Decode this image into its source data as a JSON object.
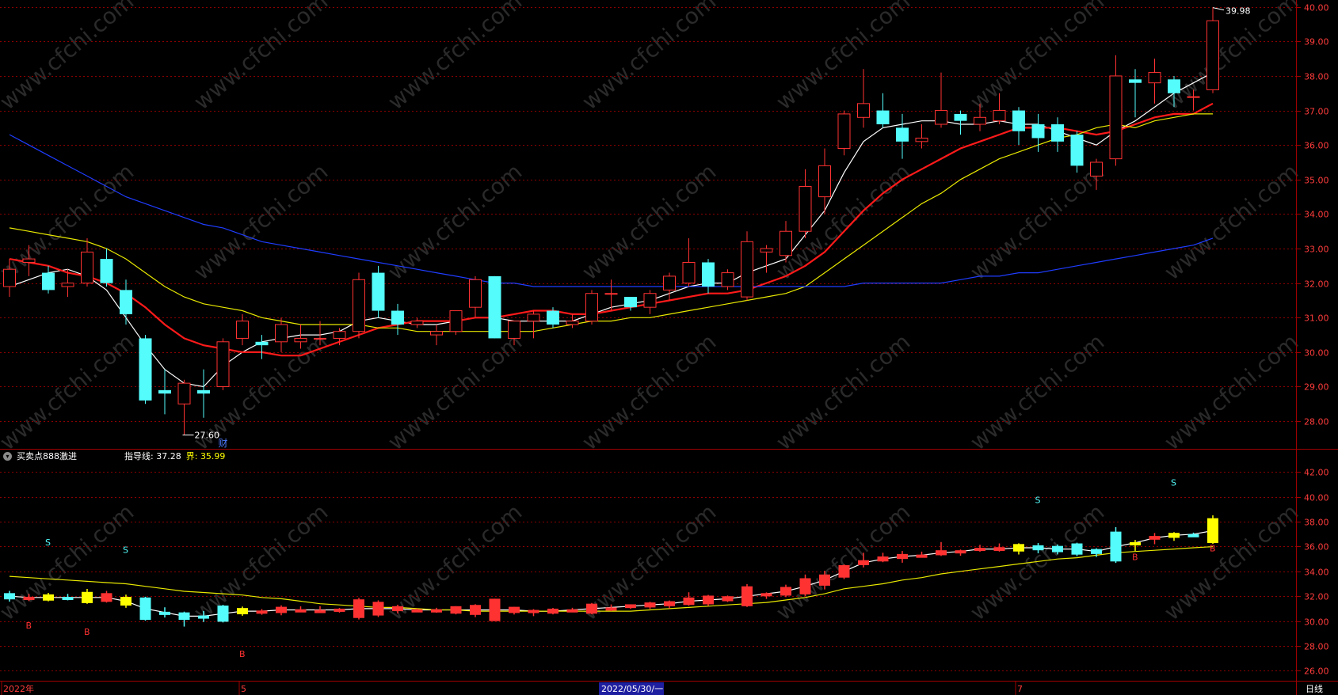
{
  "colors": {
    "background": "#000000",
    "up": "#ff3232",
    "down": "#54fcfc",
    "ma_short": "#ffffff",
    "ma_mid": "#ff1a1a",
    "ma_long": "#e8e800",
    "ma_longest": "#1f3dff",
    "grid": "#8b0000",
    "axis_text": "#ff3c3c",
    "watermark": "#2a2a2a"
  },
  "watermark": "www.cfchi.com",
  "indicator": {
    "name": "买卖点888激进",
    "guide_label": "指导线:",
    "guide_value": "37.28",
    "bound_label": "界:",
    "bound_value": "35.99"
  },
  "bottom_axis": {
    "labels": [
      {
        "text": "2022年",
        "index": 0
      },
      {
        "text": "5",
        "index": 12
      },
      {
        "text": "7",
        "index": 52
      }
    ],
    "cursor_date": "2022/05/30/一",
    "cursor_index": 32,
    "period": "日线"
  },
  "chart_data": [
    {
      "type": "candlestick",
      "ylim": [
        27.2,
        40.2
      ],
      "yticks": [
        "28.00",
        "29.00",
        "30.00",
        "31.00",
        "32.00",
        "33.00",
        "34.00",
        "35.00",
        "36.00",
        "37.00",
        "38.00",
        "39.00",
        "40.00"
      ],
      "annotations": [
        {
          "text": "39.98",
          "index": 62,
          "value": 39.98,
          "kind": "high"
        },
        {
          "text": "27.60",
          "index": 9,
          "value": 27.6,
          "kind": "low"
        },
        {
          "text": "财",
          "index": 11,
          "kind": "marker"
        }
      ],
      "candles": [
        {
          "o": 31.9,
          "h": 32.7,
          "l": 31.6,
          "c": 32.4
        },
        {
          "o": 32.6,
          "h": 33.1,
          "l": 32.2,
          "c": 32.7
        },
        {
          "o": 32.3,
          "h": 32.5,
          "l": 31.7,
          "c": 31.8
        },
        {
          "o": 31.9,
          "h": 32.4,
          "l": 31.6,
          "c": 32.0
        },
        {
          "o": 32.0,
          "h": 33.3,
          "l": 31.9,
          "c": 32.9
        },
        {
          "o": 32.7,
          "h": 33.0,
          "l": 31.9,
          "c": 32.0
        },
        {
          "o": 31.8,
          "h": 32.1,
          "l": 30.8,
          "c": 31.1
        },
        {
          "o": 30.4,
          "h": 30.5,
          "l": 28.5,
          "c": 28.6
        },
        {
          "o": 28.9,
          "h": 29.5,
          "l": 28.2,
          "c": 28.8
        },
        {
          "o": 28.5,
          "h": 29.2,
          "l": 27.6,
          "c": 29.1
        },
        {
          "o": 28.9,
          "h": 29.5,
          "l": 28.1,
          "c": 28.8
        },
        {
          "o": 29.0,
          "h": 30.4,
          "l": 28.9,
          "c": 30.3
        },
        {
          "o": 30.4,
          "h": 31.1,
          "l": 30.2,
          "c": 30.9
        },
        {
          "o": 30.3,
          "h": 30.5,
          "l": 29.8,
          "c": 30.2
        },
        {
          "o": 30.3,
          "h": 31.0,
          "l": 30.0,
          "c": 30.8
        },
        {
          "o": 30.3,
          "h": 30.8,
          "l": 30.1,
          "c": 30.4
        },
        {
          "o": 30.4,
          "h": 30.9,
          "l": 30.2,
          "c": 30.4
        },
        {
          "o": 30.4,
          "h": 30.7,
          "l": 30.2,
          "c": 30.6
        },
        {
          "o": 30.6,
          "h": 32.3,
          "l": 30.4,
          "c": 32.1
        },
        {
          "o": 32.3,
          "h": 32.5,
          "l": 31.0,
          "c": 31.2
        },
        {
          "o": 31.2,
          "h": 31.4,
          "l": 30.5,
          "c": 30.8
        },
        {
          "o": 30.8,
          "h": 31.0,
          "l": 30.7,
          "c": 30.9
        },
        {
          "o": 30.5,
          "h": 30.8,
          "l": 30.2,
          "c": 30.6
        },
        {
          "o": 30.6,
          "h": 31.2,
          "l": 30.5,
          "c": 31.2
        },
        {
          "o": 31.3,
          "h": 32.2,
          "l": 31.0,
          "c": 32.1
        },
        {
          "o": 32.2,
          "h": 32.2,
          "l": 30.4,
          "c": 30.4
        },
        {
          "o": 30.4,
          "h": 30.9,
          "l": 30.2,
          "c": 30.9
        },
        {
          "o": 30.9,
          "h": 31.2,
          "l": 30.4,
          "c": 31.1
        },
        {
          "o": 31.2,
          "h": 31.3,
          "l": 30.7,
          "c": 30.8
        },
        {
          "o": 30.8,
          "h": 31.1,
          "l": 30.7,
          "c": 30.9
        },
        {
          "o": 30.9,
          "h": 31.8,
          "l": 30.8,
          "c": 31.7
        },
        {
          "o": 31.7,
          "h": 32.1,
          "l": 31.2,
          "c": 31.7
        },
        {
          "o": 31.6,
          "h": 31.6,
          "l": 31.2,
          "c": 31.3
        },
        {
          "o": 31.3,
          "h": 31.8,
          "l": 31.1,
          "c": 31.7
        },
        {
          "o": 31.8,
          "h": 32.3,
          "l": 31.5,
          "c": 32.2
        },
        {
          "o": 32.0,
          "h": 33.3,
          "l": 31.9,
          "c": 32.6
        },
        {
          "o": 32.6,
          "h": 32.7,
          "l": 31.7,
          "c": 31.9
        },
        {
          "o": 31.9,
          "h": 32.4,
          "l": 31.8,
          "c": 32.3
        },
        {
          "o": 31.6,
          "h": 33.5,
          "l": 31.5,
          "c": 33.2
        },
        {
          "o": 32.9,
          "h": 33.1,
          "l": 32.3,
          "c": 33.0
        },
        {
          "o": 32.8,
          "h": 33.8,
          "l": 32.6,
          "c": 33.5
        },
        {
          "o": 33.5,
          "h": 35.3,
          "l": 33.3,
          "c": 34.8
        },
        {
          "o": 34.5,
          "h": 35.9,
          "l": 34.0,
          "c": 35.4
        },
        {
          "o": 35.9,
          "h": 37.0,
          "l": 35.7,
          "c": 36.9
        },
        {
          "o": 36.8,
          "h": 38.2,
          "l": 36.5,
          "c": 37.2
        },
        {
          "o": 37.0,
          "h": 37.5,
          "l": 36.5,
          "c": 36.6
        },
        {
          "o": 36.5,
          "h": 36.9,
          "l": 35.6,
          "c": 36.1
        },
        {
          "o": 36.1,
          "h": 36.6,
          "l": 35.9,
          "c": 36.2
        },
        {
          "o": 36.6,
          "h": 38.1,
          "l": 36.5,
          "c": 37.0
        },
        {
          "o": 36.9,
          "h": 37.0,
          "l": 36.3,
          "c": 36.7
        },
        {
          "o": 36.6,
          "h": 37.2,
          "l": 36.4,
          "c": 36.8
        },
        {
          "o": 36.7,
          "h": 37.5,
          "l": 36.6,
          "c": 37.0
        },
        {
          "o": 37.0,
          "h": 37.1,
          "l": 36.0,
          "c": 36.4
        },
        {
          "o": 36.6,
          "h": 36.9,
          "l": 35.8,
          "c": 36.2
        },
        {
          "o": 36.6,
          "h": 36.8,
          "l": 35.8,
          "c": 36.1
        },
        {
          "o": 36.3,
          "h": 36.4,
          "l": 35.2,
          "c": 35.4
        },
        {
          "o": 35.1,
          "h": 35.6,
          "l": 34.7,
          "c": 35.5
        },
        {
          "o": 35.6,
          "h": 38.6,
          "l": 35.4,
          "c": 38.0
        },
        {
          "o": 37.9,
          "h": 38.2,
          "l": 36.8,
          "c": 37.8
        },
        {
          "o": 37.8,
          "h": 38.5,
          "l": 37.2,
          "c": 38.1
        },
        {
          "o": 37.9,
          "h": 38.0,
          "l": 37.1,
          "c": 37.5
        },
        {
          "o": 37.4,
          "h": 37.6,
          "l": 37.0,
          "c": 37.4
        },
        {
          "o": 37.6,
          "h": 39.98,
          "l": 37.5,
          "c": 39.6
        }
      ],
      "series": [
        {
          "color": "#ffffff",
          "values": [
            31.9,
            32.1,
            32.3,
            32.4,
            32.2,
            31.8,
            31.0,
            30.2,
            29.5,
            29.1,
            29.0,
            29.6,
            30.0,
            30.3,
            30.4,
            30.5,
            30.5,
            30.6,
            30.9,
            31.0,
            30.9,
            30.8,
            30.8,
            30.9,
            31.0,
            31.0,
            30.9,
            30.9,
            30.9,
            30.9,
            31.1,
            31.3,
            31.4,
            31.5,
            31.7,
            31.9,
            32.0,
            32.0,
            32.3,
            32.5,
            32.7,
            33.4,
            34.1,
            35.2,
            36.1,
            36.5,
            36.6,
            36.7,
            36.7,
            36.6,
            36.6,
            36.7,
            36.6,
            36.6,
            36.4,
            36.2,
            36.0,
            36.4,
            36.7,
            37.1,
            37.5,
            37.8,
            38.1
          ]
        },
        {
          "color": "#ff1a1a",
          "values": [
            32.7,
            32.6,
            32.5,
            32.3,
            32.2,
            32.0,
            31.7,
            31.3,
            30.8,
            30.4,
            30.2,
            30.1,
            30.0,
            30.0,
            29.9,
            29.9,
            30.1,
            30.3,
            30.5,
            30.7,
            30.8,
            30.9,
            30.9,
            30.9,
            31.0,
            31.0,
            31.1,
            31.2,
            31.2,
            31.1,
            31.1,
            31.2,
            31.3,
            31.4,
            31.5,
            31.6,
            31.7,
            31.7,
            31.8,
            32.0,
            32.2,
            32.5,
            32.9,
            33.5,
            34.1,
            34.6,
            35.0,
            35.3,
            35.6,
            35.9,
            36.1,
            36.3,
            36.5,
            36.5,
            36.5,
            36.4,
            36.3,
            36.4,
            36.6,
            36.8,
            36.9,
            36.9,
            37.2
          ]
        },
        {
          "color": "#e8e800",
          "values": [
            33.6,
            33.5,
            33.4,
            33.3,
            33.2,
            33.0,
            32.7,
            32.3,
            31.9,
            31.6,
            31.4,
            31.3,
            31.2,
            31.0,
            30.9,
            30.8,
            30.8,
            30.8,
            30.8,
            30.7,
            30.7,
            30.6,
            30.6,
            30.6,
            30.6,
            30.6,
            30.6,
            30.6,
            30.7,
            30.8,
            30.9,
            30.9,
            31.0,
            31.0,
            31.1,
            31.2,
            31.3,
            31.4,
            31.5,
            31.6,
            31.7,
            31.9,
            32.3,
            32.7,
            33.1,
            33.5,
            33.9,
            34.3,
            34.6,
            35.0,
            35.3,
            35.6,
            35.8,
            36.0,
            36.2,
            36.3,
            36.5,
            36.6,
            36.5,
            36.7,
            36.8,
            36.9,
            36.9
          ]
        },
        {
          "color": "#1f3dff",
          "values": [
            36.3,
            36.0,
            35.7,
            35.4,
            35.1,
            34.8,
            34.5,
            34.3,
            34.1,
            33.9,
            33.7,
            33.6,
            33.4,
            33.2,
            33.1,
            33.0,
            32.9,
            32.8,
            32.7,
            32.6,
            32.5,
            32.4,
            32.3,
            32.2,
            32.1,
            32.0,
            32.0,
            31.9,
            31.9,
            31.9,
            31.9,
            31.9,
            31.9,
            31.9,
            31.9,
            31.9,
            31.9,
            31.9,
            31.9,
            31.9,
            31.9,
            31.9,
            31.9,
            31.9,
            32.0,
            32.0,
            32.0,
            32.0,
            32.0,
            32.1,
            32.2,
            32.2,
            32.3,
            32.3,
            32.4,
            32.5,
            32.6,
            32.7,
            32.8,
            32.9,
            33.0,
            33.1,
            33.3
          ]
        }
      ]
    },
    {
      "type": "candlestick",
      "ylim": [
        25.2,
        43.8
      ],
      "yticks": [
        "26.00",
        "28.00",
        "30.00",
        "32.00",
        "34.00",
        "36.00",
        "38.00",
        "40.00",
        "42.00"
      ],
      "series": [
        {
          "name": "指导线",
          "color": "#ffffff",
          "values": [
            32.0,
            31.9,
            31.9,
            31.9,
            31.9,
            31.9,
            31.6,
            31.0,
            30.7,
            30.4,
            30.4,
            30.6,
            30.8,
            30.8,
            30.9,
            30.9,
            30.9,
            30.9,
            31.0,
            31.0,
            31.0,
            30.9,
            30.9,
            30.9,
            30.9,
            30.9,
            30.9,
            30.8,
            30.8,
            30.9,
            31.0,
            31.1,
            31.2,
            31.3,
            31.4,
            31.6,
            31.7,
            31.8,
            32.0,
            32.2,
            32.4,
            32.8,
            33.3,
            34.0,
            34.7,
            35.0,
            35.2,
            35.3,
            35.5,
            35.6,
            35.8,
            35.8,
            35.9,
            35.9,
            35.8,
            35.8,
            35.6,
            36.0,
            36.3,
            36.7,
            36.9,
            37.0,
            37.28
          ]
        },
        {
          "name": "界",
          "color": "#e8e800",
          "values": [
            33.6,
            33.5,
            33.4,
            33.3,
            33.2,
            33.1,
            33.0,
            32.8,
            32.6,
            32.4,
            32.3,
            32.2,
            32.1,
            31.9,
            31.8,
            31.6,
            31.4,
            31.3,
            31.2,
            31.1,
            31.1,
            31.0,
            30.9,
            30.9,
            30.8,
            30.8,
            30.8,
            30.8,
            30.8,
            30.8,
            30.8,
            30.8,
            30.8,
            30.9,
            31.0,
            31.1,
            31.2,
            31.3,
            31.4,
            31.5,
            31.7,
            31.9,
            32.2,
            32.6,
            32.8,
            33.0,
            33.3,
            33.5,
            33.8,
            34.0,
            34.2,
            34.4,
            34.6,
            34.8,
            35.0,
            35.1,
            35.3,
            35.5,
            35.6,
            35.7,
            35.8,
            35.9,
            35.99
          ]
        }
      ],
      "candle_colors": [
        "down",
        "up",
        "yellow",
        "down",
        "yellow",
        "up",
        "yellow",
        "down",
        "down",
        "down",
        "down",
        "down",
        "yellow",
        "up",
        "up",
        "up",
        "up",
        "up",
        "up",
        "up",
        "up",
        "up",
        "up",
        "up",
        "up",
        "up",
        "up",
        "up",
        "up",
        "up",
        "up",
        "up",
        "up",
        "up",
        "up",
        "up",
        "up",
        "up",
        "up",
        "up",
        "up",
        "up",
        "up",
        "up",
        "up",
        "up",
        "up",
        "up",
        "up",
        "up",
        "up",
        "up",
        "yellow",
        "down",
        "down",
        "down",
        "down",
        "down",
        "yellow",
        "up",
        "yellow",
        "down",
        "yellow"
      ],
      "signals": [
        {
          "text": "S",
          "index": 2,
          "value": 36.1,
          "color": "#54fcfc"
        },
        {
          "text": "S",
          "index": 6,
          "value": 35.5,
          "color": "#54fcfc"
        },
        {
          "text": "S",
          "index": 53,
          "value": 39.5,
          "color": "#54fcfc"
        },
        {
          "text": "S",
          "index": 60,
          "value": 40.9,
          "color": "#54fcfc"
        },
        {
          "text": "B",
          "index": 1,
          "value": 29.4,
          "color": "#ff3232"
        },
        {
          "text": "B",
          "index": 4,
          "value": 28.9,
          "color": "#ff3232"
        },
        {
          "text": "B",
          "index": 12,
          "value": 27.1,
          "color": "#ff3232"
        },
        {
          "text": "B",
          "index": 58,
          "value": 34.9,
          "color": "#ff3232"
        },
        {
          "text": "B",
          "index": 62,
          "value": 35.6,
          "color": "#ff3232"
        }
      ]
    }
  ]
}
